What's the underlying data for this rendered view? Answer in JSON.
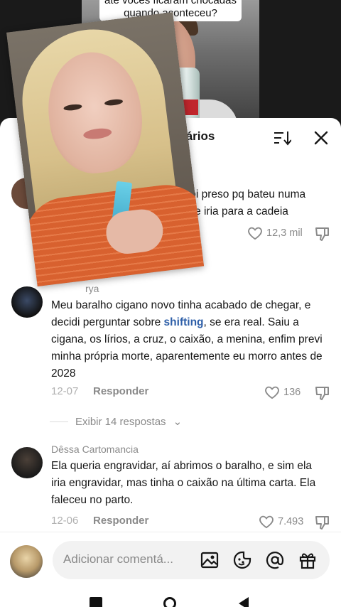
{
  "video": {
    "caption": "ate vocês ficaram chocadas quando aconteceu?"
  },
  "sheet": {
    "title": "59 comentários",
    "icons": {
      "sort": "sort-icon",
      "close": "close-icon"
    }
  },
  "comments": [
    {
      "text_line1": "e foi preso pq bateu numa",
      "text_line2": "ele iria para a cadeia",
      "likes": "12,3 mil"
    },
    {
      "username": "rya",
      "text_before": "Meu baralho cigano novo tinha acabado de chegar, e decidi perguntar sobre ",
      "hashtag": "shifting",
      "text_after": ", se era real. Saiu a cigana, os lírios, a cruz, o caixão, a menina, enfim previ minha própria morte, aparentemente eu morro antes de 2028",
      "date": "12-07",
      "reply_label": "Responder",
      "likes": "136",
      "view_replies": "Exibir 14 respostas"
    },
    {
      "username": "Dêssa Cartomancia",
      "text": "Ela queria engravidar, aí abrimos o baralho, e sim ela iria engravidar, mas tinha o caixão na última carta. Ela faleceu no parto.",
      "date": "12-06",
      "reply_label": "Responder",
      "likes": "7.493"
    }
  ],
  "input": {
    "placeholder": "Adicionar comentá...",
    "icons": [
      "image-icon",
      "emoji-icon",
      "mention-icon",
      "gift-icon"
    ]
  },
  "colors": {
    "hashtag": "#2e5fa8",
    "muted": "#8a8a8a"
  }
}
